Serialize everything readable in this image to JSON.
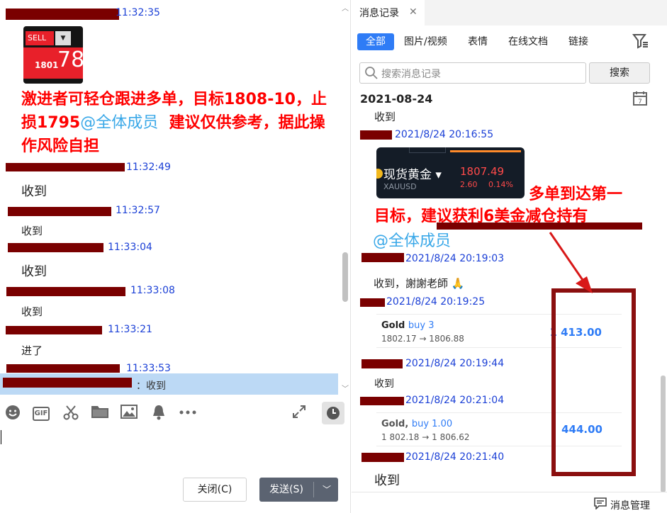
{
  "chat": {
    "messages": [
      {
        "time": "11:32:35"
      },
      {
        "text": "激进者可轻仓跟进多单，目标1808-10，止损1795",
        "mention": "@全体成员",
        "tail": "建议仅供参考，据此操作风险自担"
      },
      {
        "time": "11:32:49",
        "text": "收到"
      },
      {
        "time": "11:32:57",
        "text": "收到"
      },
      {
        "time": "11:33:04",
        "text": "收到"
      },
      {
        "time": "11:33:08",
        "text": "收到"
      },
      {
        "time": "11:33:21",
        "text": "进了"
      },
      {
        "time": "11:33:53"
      }
    ],
    "stock_image": {
      "sell_label": "SELL",
      "bid": "1801",
      "big_digits": "78"
    },
    "reply_quote": "：收到",
    "toolbar_icons": [
      "emoji-icon",
      "gif-icon",
      "scissors-icon",
      "folder-icon",
      "image-icon",
      "bell-icon",
      "more-icon",
      "expand-icon",
      "clock-icon"
    ],
    "gif_label": "GIF",
    "close_button": "关闭(C)",
    "send_button": "发送(S)"
  },
  "history": {
    "tab_title": "消息记录",
    "categories": [
      "全部",
      "图片/视频",
      "表情",
      "在线文档",
      "链接"
    ],
    "search_placeholder": "搜索消息记录",
    "search_button": "搜索",
    "date": "2021-08-24",
    "first_text": "收到",
    "entries": [
      {
        "time": "2021/8/24 20:16:55"
      },
      {
        "time": "2021/8/24 20:19:03",
        "text": "收到，謝謝老師"
      },
      {
        "time": "2021/8/24 20:19:25"
      },
      {
        "time": "2021/8/24 20:19:44",
        "text": "收到"
      },
      {
        "time": "2021/8/24 20:21:04"
      },
      {
        "time": "2021/8/24 20:21:40",
        "text": "收到"
      }
    ],
    "gold_card": {
      "name": "现货黄金",
      "price": "1807.49",
      "symbol": "XAUUSD",
      "change": "2.60",
      "percent": "0.14%"
    },
    "annotation_line1": "多单到达第一",
    "annotation_line2": "目标，建议获利6美金减仓持有",
    "mention": "@全体成员",
    "trades": [
      {
        "symbol": "Gold",
        "side": "buy 3",
        "range": "1802.17 → 1806.88",
        "profit": "1 413.00"
      },
      {
        "symbol": "Gold,",
        "side": "buy 1.00",
        "range": "1 802.18 → 1 806.62",
        "profit": "444.00"
      }
    ],
    "footer_label": "消息管理",
    "colors": {
      "accent": "#2f7cf6",
      "annotation": "#ff0000",
      "redact": "#7a0000",
      "highlight_box": "#8b0f0f"
    }
  }
}
